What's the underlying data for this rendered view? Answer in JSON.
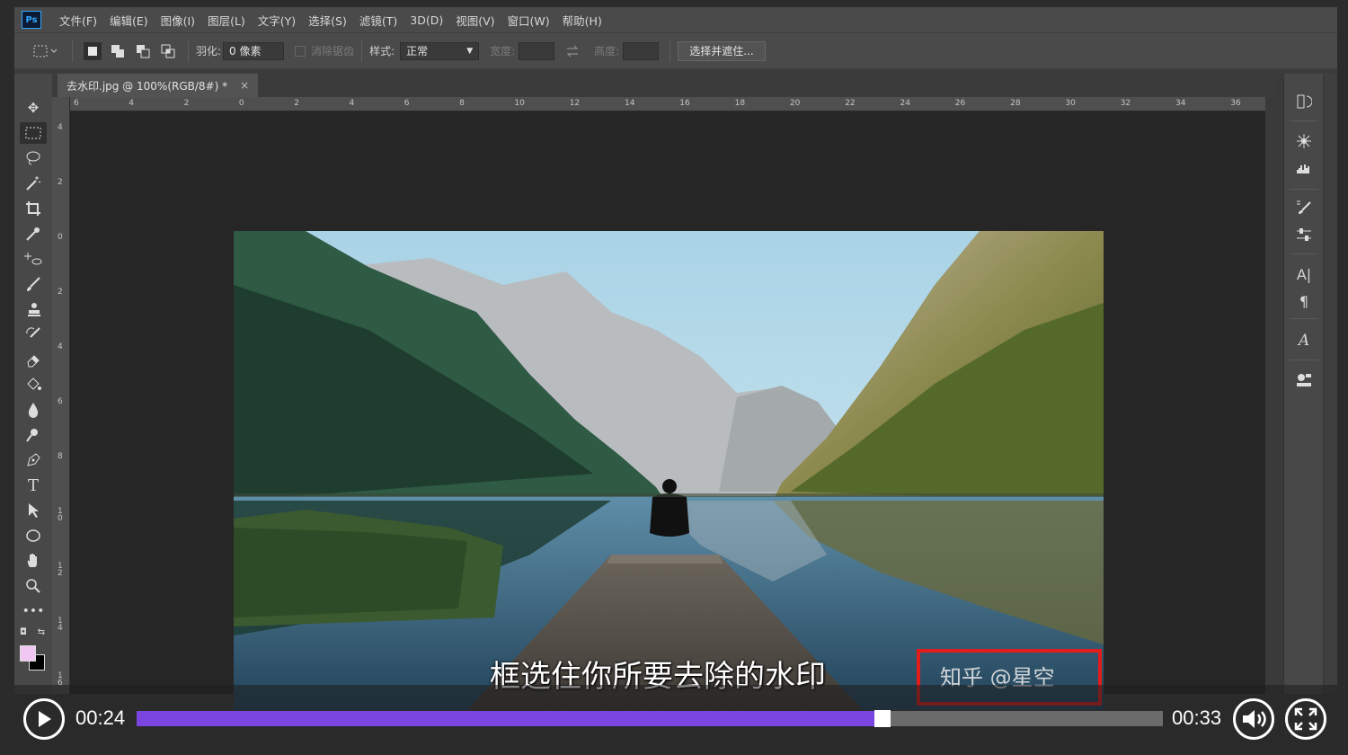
{
  "app": {
    "logo": "Ps"
  },
  "menu": [
    "文件(F)",
    "编辑(E)",
    "图像(I)",
    "图层(L)",
    "文字(Y)",
    "选择(S)",
    "滤镜(T)",
    "3D(D)",
    "视图(V)",
    "窗口(W)",
    "帮助(H)"
  ],
  "options": {
    "feather_label": "羽化:",
    "feather_value": "0 像素",
    "antialias_label": "消除锯齿",
    "style_label": "样式:",
    "style_value": "正常",
    "width_label": "宽度:",
    "height_label": "高度:",
    "select_mask_button": "选择并遮住..."
  },
  "document": {
    "tab_title": "去水印.jpg @ 100%(RGB/8#) *",
    "close_symbol": "×"
  },
  "rulers": {
    "h": [
      "6",
      "4",
      "2",
      "0",
      "2",
      "4",
      "6",
      "8",
      "10",
      "12",
      "14",
      "16",
      "18",
      "20",
      "22",
      "24",
      "26",
      "28",
      "30",
      "32",
      "34",
      "36"
    ],
    "v": [
      "4",
      "2",
      "0",
      "2",
      "4",
      "6",
      "8",
      "1\n0",
      "1\n2",
      "1\n4",
      "1\n6"
    ]
  },
  "canvas": {
    "subtitle": "框选住你所要去除的水印",
    "watermark": "知乎 @星空"
  },
  "colors": {
    "foreground": "#f0c6f2",
    "background": "#000000",
    "accent": "#7a45e0",
    "highlight_box": "#e21b1b"
  },
  "player": {
    "current_time": "00:24",
    "total_time": "00:33",
    "progress": 0.727
  }
}
